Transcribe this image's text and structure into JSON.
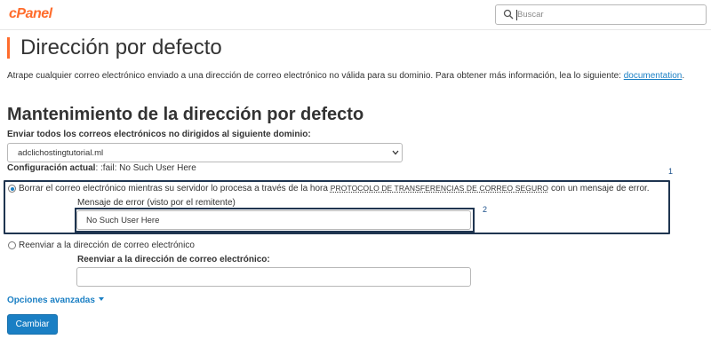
{
  "header": {
    "logo": "cPanel",
    "search_placeholder": "Buscar"
  },
  "page": {
    "title": "Dirección por defecto",
    "intro_text": "Atrape cualquier correo electrónico enviado a una dirección de correo electrónico no válida para su dominio. Para obtener más información, lea lo siguiente:",
    "intro_link": "documentation",
    "intro_end": "."
  },
  "maintenance": {
    "title": "Mantenimiento de la dirección por defecto",
    "domain_label": "Enviar todos los correos electrónicos no dirigidos al siguiente dominio:",
    "domain_value": "adclichostingtutorial.ml",
    "current_config_label": "Configuración actual",
    "current_config_value": ": :fail: No Such User Here"
  },
  "options": {
    "discard": {
      "label_start": "Borrar el correo electrónico mientras su servidor lo procesa a través de la hora",
      "label_protocol": "PROTOCOLO DE TRANSFERENCIAS DE CORREO SEGURO",
      "label_end": "con un mensaje de error.",
      "selected": true,
      "field_label": "Mensaje de error (visto por el remitente)",
      "field_value": "No Such User Here"
    },
    "forward": {
      "label": "Reenviar a la dirección de correo electrónico",
      "selected": false,
      "field_label": "Reenviar a la dirección de correo electrónico:",
      "field_value": ""
    }
  },
  "annotations": {
    "box1_number": "1",
    "box2_number": "2"
  },
  "advanced_label": "Opciones avanzadas",
  "submit_label": "Cambiar",
  "colors": {
    "brand": "#ff6c2c",
    "link": "#1a7fc4",
    "highlight_border": "#1f3550"
  }
}
